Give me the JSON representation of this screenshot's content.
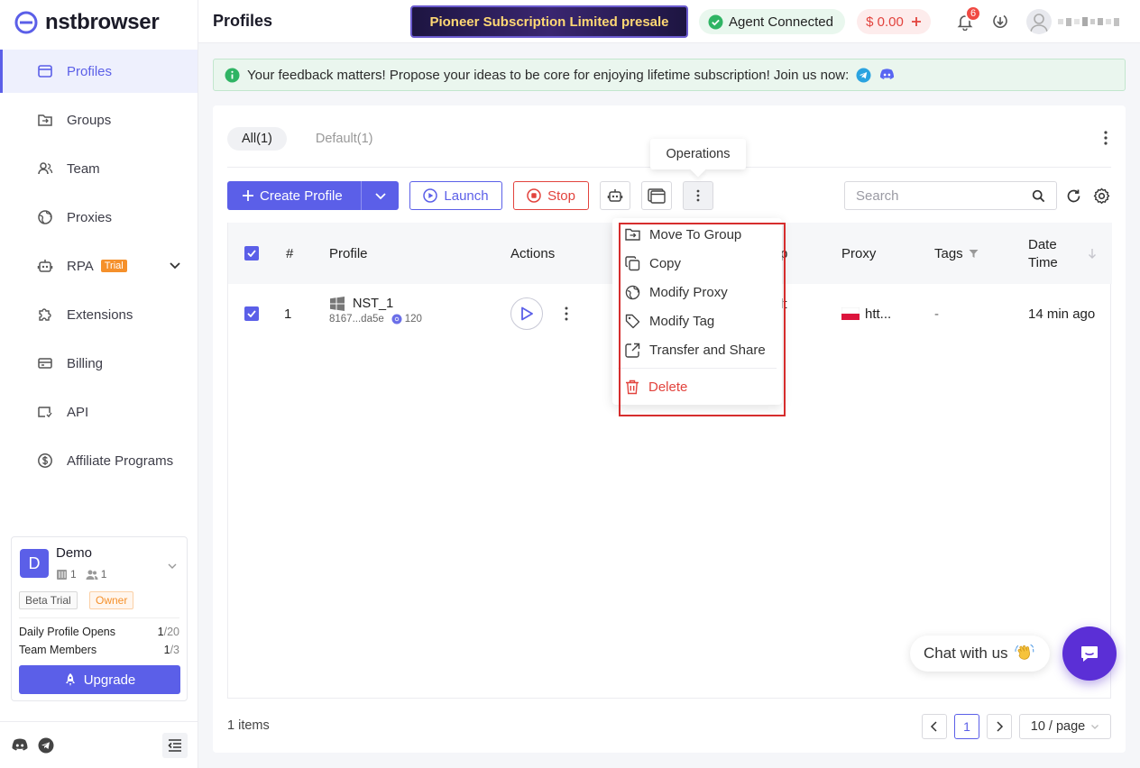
{
  "app": {
    "brand": "nstbrowser"
  },
  "sidebar": {
    "items": [
      {
        "label": "Profiles"
      },
      {
        "label": "Groups"
      },
      {
        "label": "Team"
      },
      {
        "label": "Proxies"
      },
      {
        "label": "RPA",
        "tag": "Trial"
      },
      {
        "label": "Extensions"
      },
      {
        "label": "Billing"
      },
      {
        "label": "API"
      },
      {
        "label": "Affiliate Programs"
      }
    ],
    "team": {
      "avatar_letter": "D",
      "name": "Demo",
      "group_count": "1",
      "member_count": "1",
      "badge_plan": "Beta Trial",
      "badge_role": "Owner",
      "daily_opens_label": "Daily Profile Opens",
      "daily_opens_used": "1",
      "daily_opens_total": "/20",
      "members_label": "Team Members",
      "members_used": "1",
      "members_total": "/3",
      "upgrade_label": "Upgrade"
    }
  },
  "header": {
    "title": "Profiles",
    "promo": "Pioneer Subscription Limited presale",
    "agent_status": "Agent Connected",
    "balance": "$ 0.00",
    "notification_count": "6"
  },
  "banner": {
    "text": "Your feedback matters! Propose your ideas to be core for enjoying lifetime subscription! Join us now:"
  },
  "tabs": [
    {
      "label": "All(1)"
    },
    {
      "label": "Default(1)"
    }
  ],
  "toolbar": {
    "create_label": "Create Profile",
    "launch_label": "Launch",
    "stop_label": "Stop",
    "search_placeholder": "Search",
    "operations_tooltip": "Operations"
  },
  "table": {
    "columns": {
      "index": "#",
      "profile": "Profile",
      "actions": "Actions",
      "group_partial": "p",
      "proxy": "Proxy",
      "tags": "Tags",
      "date_line1": "Date",
      "date_line2": "Time"
    },
    "rows": [
      {
        "index": "1",
        "name": "NST_1",
        "id": "8167...da5e",
        "kernel": "120",
        "group_partial": "lt",
        "proxy": "htt...",
        "tags": "-",
        "date": "14 min ago"
      }
    ]
  },
  "operations_menu": {
    "items": [
      {
        "label": "Move To Group"
      },
      {
        "label": "Copy"
      },
      {
        "label": "Modify Proxy"
      },
      {
        "label": "Modify Tag"
      },
      {
        "label": "Transfer and Share"
      },
      {
        "label": "Delete"
      }
    ]
  },
  "footer": {
    "items_count": "1 items",
    "current_page": "1",
    "page_size": "10 / page"
  },
  "chat": {
    "label": "Chat with us"
  },
  "colors": {
    "accent": "#5b5fe8",
    "danger": "#e2433d",
    "success": "#2fb464",
    "warning": "#f5902b"
  }
}
